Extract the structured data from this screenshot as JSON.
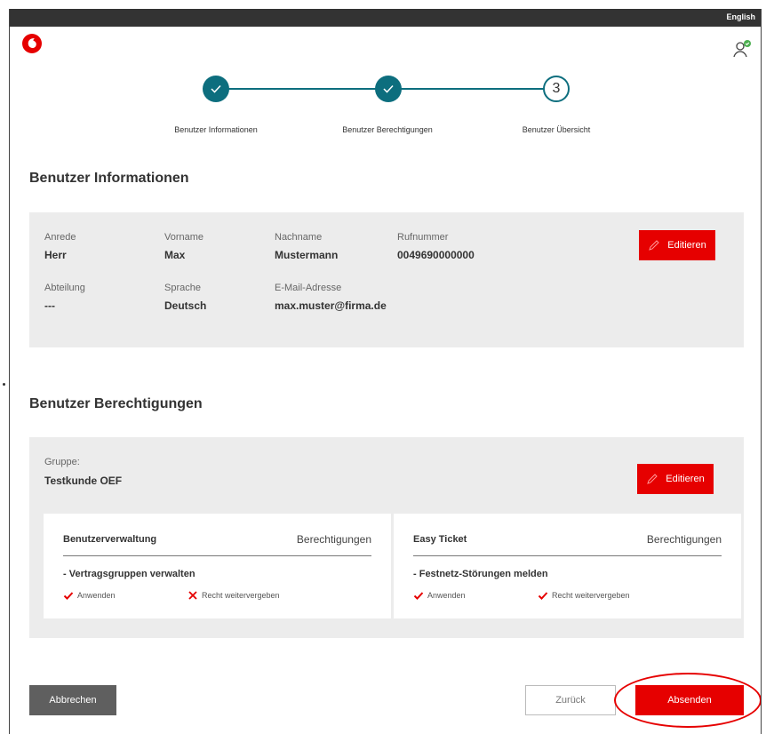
{
  "header": {
    "language_link": "English"
  },
  "stepper": {
    "steps": [
      {
        "label": "Benutzer Informationen",
        "state": "done"
      },
      {
        "label": "Benutzer Berechtigungen",
        "state": "done"
      },
      {
        "label": "Benutzer Übersicht",
        "state": "current",
        "number": "3"
      }
    ]
  },
  "info": {
    "title": "Benutzer Informationen",
    "fields": {
      "anrede": {
        "label": "Anrede",
        "value": "Herr"
      },
      "vorname": {
        "label": "Vorname",
        "value": "Max"
      },
      "nachname": {
        "label": "Nachname",
        "value": "Mustermann"
      },
      "rufnummer": {
        "label": "Rufnummer",
        "value": "0049690000000"
      },
      "abteilung": {
        "label": "Abteilung",
        "value": "---"
      },
      "sprache": {
        "label": "Sprache",
        "value": "Deutsch"
      },
      "email": {
        "label": "E-Mail-Adresse",
        "value": "max.muster@firma.de"
      }
    },
    "edit_label": "Editieren"
  },
  "permissions": {
    "title": "Benutzer Berechtigungen",
    "group_label": "Gruppe:",
    "group_value": "Testkunde OEF",
    "edit_label": "Editieren",
    "cards": [
      {
        "title": "Benutzerverwaltung",
        "header_right": "Berechtigungen",
        "item": "- Vertragsgruppen verwalten",
        "apply": {
          "label": "Anwenden",
          "granted": true
        },
        "delegate": {
          "label": "Recht weitervergeben",
          "granted": false
        }
      },
      {
        "title": "Easy Ticket",
        "header_right": "Berechtigungen",
        "item": "- Festnetz-Störungen melden",
        "apply": {
          "label": "Anwenden",
          "granted": true
        },
        "delegate": {
          "label": "Recht weitervergeben",
          "granted": true
        }
      }
    ]
  },
  "actions": {
    "cancel": "Abbrechen",
    "back": "Zurück",
    "submit": "Absenden"
  },
  "colors": {
    "brand_red": "#e60000",
    "step_teal": "#0d6e7e",
    "panel_gray": "#ececec",
    "topbar": "#333333"
  },
  "icons": [
    "vodafone-logo",
    "user-check-icon",
    "check-icon",
    "pencil-icon",
    "cross-icon"
  ]
}
